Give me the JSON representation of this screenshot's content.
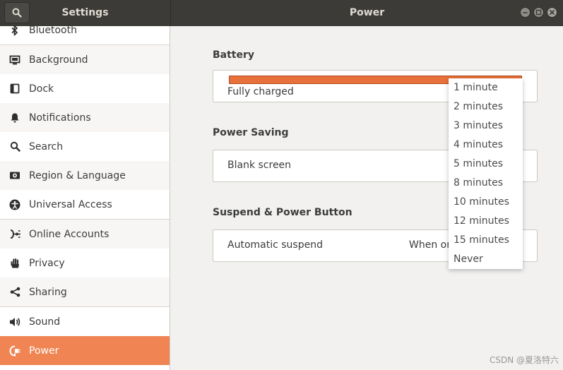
{
  "header": {
    "sidebar_title": "Settings",
    "panel_title": "Power"
  },
  "sidebar": {
    "items": [
      {
        "label": "Bluetooth",
        "icon": "bluetooth-icon"
      },
      {
        "label": "Background",
        "icon": "background-icon"
      },
      {
        "label": "Dock",
        "icon": "dock-icon"
      },
      {
        "label": "Notifications",
        "icon": "bell-icon"
      },
      {
        "label": "Search",
        "icon": "search-icon"
      },
      {
        "label": "Region & Language",
        "icon": "region-icon"
      },
      {
        "label": "Universal Access",
        "icon": "accessibility-icon"
      },
      {
        "label": "Online Accounts",
        "icon": "online-accounts-icon"
      },
      {
        "label": "Privacy",
        "icon": "hand-icon"
      },
      {
        "label": "Sharing",
        "icon": "share-icon"
      },
      {
        "label": "Sound",
        "icon": "speaker-icon"
      },
      {
        "label": "Power",
        "icon": "power-plug-icon",
        "active": true
      }
    ]
  },
  "battery": {
    "title": "Battery",
    "status": "Fully charged",
    "level": 1.0,
    "bar_color": "#e8703a"
  },
  "power_saving": {
    "title": "Power Saving",
    "blank_screen_label": "Blank screen"
  },
  "suspend": {
    "title": "Suspend & Power Button",
    "automatic_suspend_label": "Automatic suspend",
    "automatic_suspend_value": "When on"
  },
  "blank_screen_menu": {
    "options": [
      "1 minute",
      "2 minutes",
      "3 minutes",
      "4 minutes",
      "5 minutes",
      "8 minutes",
      "10 minutes",
      "12 minutes",
      "15 minutes",
      "Never"
    ]
  },
  "watermark": "CSDN @夏洛特六",
  "colors": {
    "accent": "#f08553",
    "header": "#3c3b37"
  }
}
